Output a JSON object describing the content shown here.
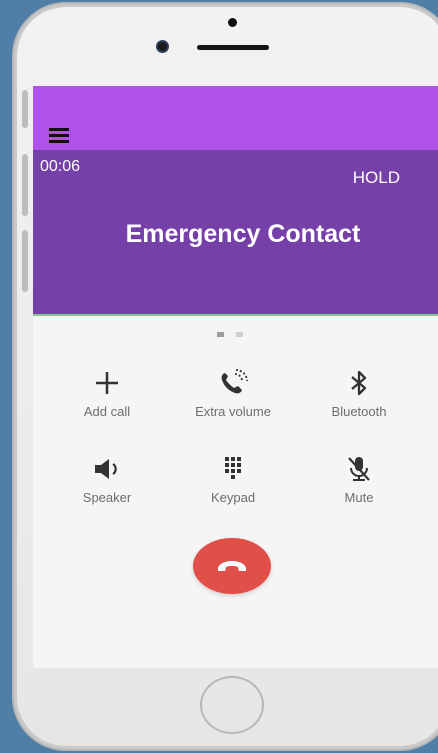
{
  "call": {
    "timer": "00:06",
    "hold_label": "HOLD",
    "contact_name": "Emergency Contact"
  },
  "actions": [
    {
      "label": "Add call",
      "icon": "plus-icon"
    },
    {
      "label": "Extra volume",
      "icon": "extra-volume-icon"
    },
    {
      "label": "Bluetooth",
      "icon": "bluetooth-icon"
    },
    {
      "label": "Speaker",
      "icon": "speaker-icon"
    },
    {
      "label": "Keypad",
      "icon": "keypad-icon"
    },
    {
      "label": "Mute",
      "icon": "mute-icon"
    }
  ],
  "pager": {
    "pages": 2,
    "active": 1
  },
  "colors": {
    "appbar": "#b052ea",
    "header": "#7640a9",
    "end_call": "#e05048",
    "background": "#4f7ea6"
  }
}
